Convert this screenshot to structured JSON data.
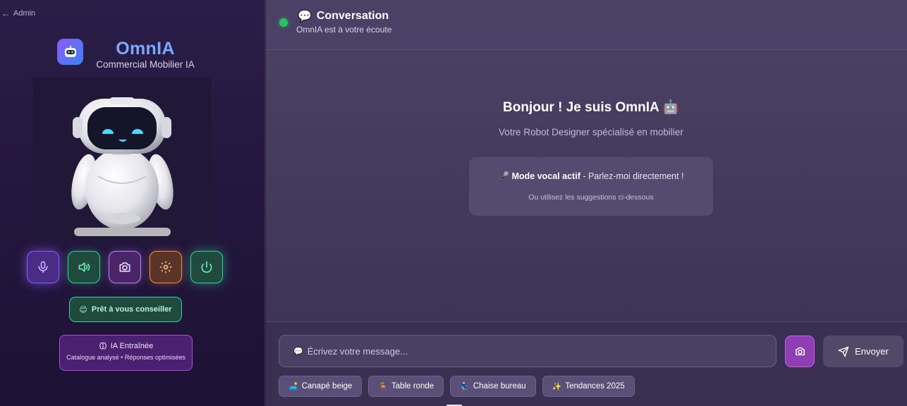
{
  "sidebar": {
    "back_label": "Admin",
    "brand_name": "OmnIA",
    "brand_subtitle": "Commercial Mobilier IA",
    "controls": [
      {
        "icon": "microphone-icon"
      },
      {
        "icon": "speaker-icon"
      },
      {
        "icon": "camera-icon"
      },
      {
        "icon": "gear-icon"
      },
      {
        "icon": "power-icon"
      }
    ],
    "status_emoji": "😊",
    "status_label": "Prêt à vous conseiller",
    "trained_title": "IA Entraînée",
    "trained_subtitle": "Catalogue analysé • Réponses optimisées"
  },
  "header": {
    "icon": "💬",
    "title": "Conversation",
    "subtitle": "OmnIA est à votre écoute",
    "status_color": "#22c55e"
  },
  "welcome": {
    "title": "Bonjour ! Je suis OmnIA 🤖",
    "subtitle": "Votre Robot Designer spécialisé en mobilier",
    "vocal_icon": "🎤",
    "vocal_bold": "Mode vocal actif",
    "vocal_text": " - Parlez-moi directement !",
    "vocal_hint": "Ou utilisez les suggestions ci-dessous"
  },
  "composer": {
    "input_icon": "💬",
    "placeholder": "Écrivez votre message...",
    "send_label": "Envoyer"
  },
  "suggestions": [
    {
      "icon": "🛋️",
      "label": "Canapé beige"
    },
    {
      "icon": "🪑",
      "label": "Table ronde"
    },
    {
      "icon": "💺",
      "label": "Chaise bureau"
    },
    {
      "icon": "✨",
      "label": "Tendances 2025"
    }
  ]
}
